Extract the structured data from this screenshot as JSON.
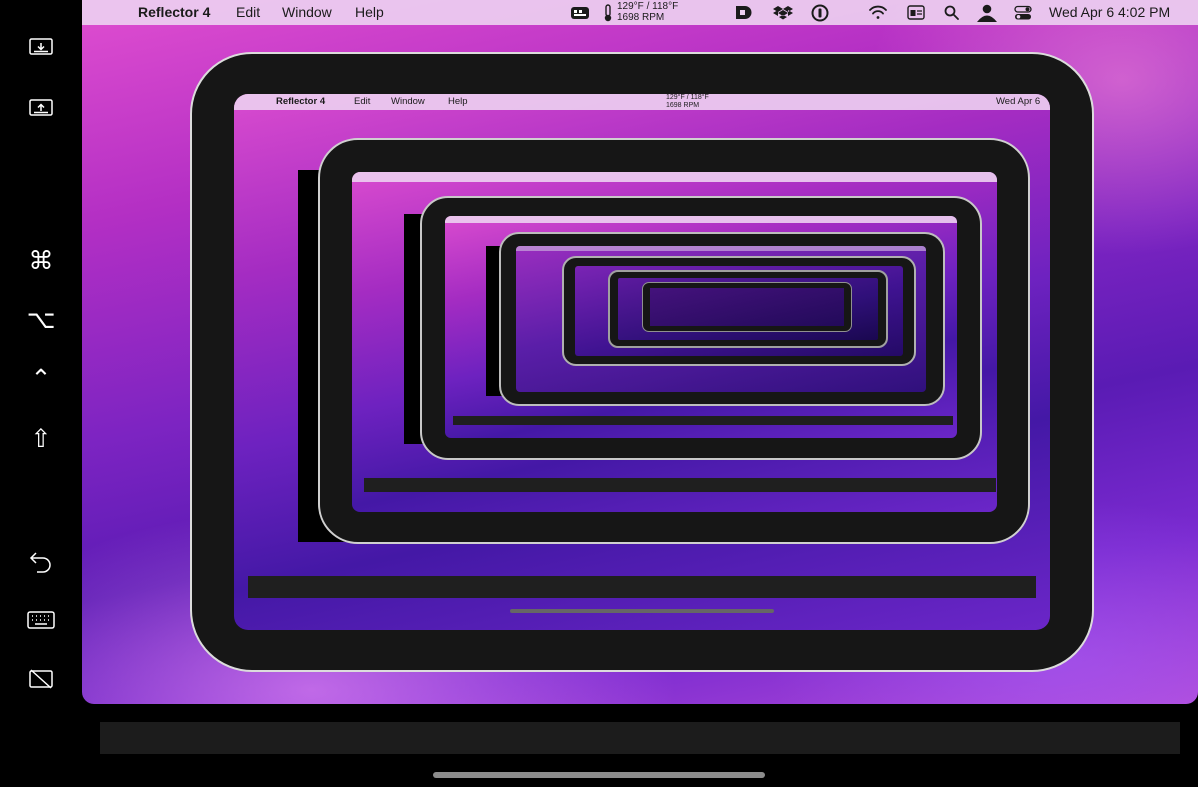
{
  "sidebar": {
    "items": [
      {
        "name": "receive-screen-icon",
        "glyph": ""
      },
      {
        "name": "send-screen-icon",
        "glyph": ""
      },
      {
        "name": "command-key",
        "glyph": "⌘"
      },
      {
        "name": "option-key",
        "glyph": "⌥"
      },
      {
        "name": "control-key",
        "glyph": "⌃"
      },
      {
        "name": "shift-key",
        "glyph": "⇧"
      },
      {
        "name": "undo-icon",
        "glyph": ""
      },
      {
        "name": "keyboard-icon",
        "glyph": ""
      },
      {
        "name": "hide-display-icon",
        "glyph": ""
      }
    ]
  },
  "menubar": {
    "apple": "",
    "app_name": "Reflector 4",
    "menus": [
      "Edit",
      "Window",
      "Help"
    ],
    "temperature": "129°F / 118°F",
    "fan_rpm": "1698 RPM",
    "datetime": "Wed Apr 6  4:02 PM"
  },
  "nested": {
    "app_name": "Reflector 4",
    "menus": [
      "Edit",
      "Window",
      "Help"
    ],
    "temperature": "129°F / 118°F",
    "fan_rpm": "1698 RPM",
    "datetime_partial": "Wed Apr 6"
  },
  "colors": {
    "accent_top": "#e04ed0",
    "accent_mid": "#7d24c2",
    "accent_deep": "#5a1bb4",
    "frame": "#161616",
    "frame_edge": "#dcdcdc"
  }
}
